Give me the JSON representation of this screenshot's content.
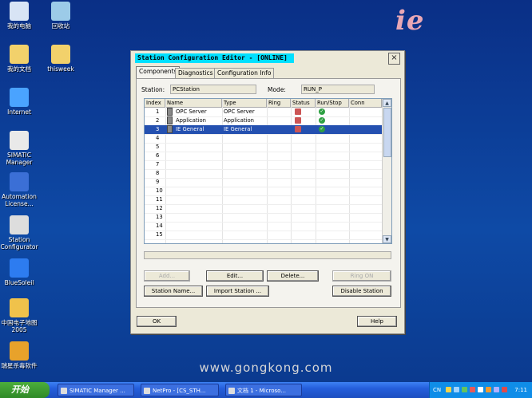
{
  "desktop": {
    "icons": [
      {
        "label": "我的电脑",
        "icon": "my-computer-icon",
        "color": "#d8e4f5"
      },
      {
        "label": "回收站",
        "icon": "recycle-bin-icon",
        "color": "#9ccbe8"
      },
      {
        "label": "我的文档",
        "icon": "my-documents-icon",
        "color": "#f2d16b"
      },
      {
        "label": "thisweek",
        "icon": "folder-icon",
        "color": "#f2d16b"
      },
      {
        "label": "Internet",
        "icon": "internet-explorer-icon",
        "color": "#4aa3ff"
      },
      {
        "label": "SIMATIC\nManager",
        "icon": "simatic-manager-icon",
        "color": "#e9e9e9"
      },
      {
        "label": "Automation\nLicense...",
        "icon": "automation-license-icon",
        "color": "#3b6fd6"
      },
      {
        "label": "Station\nConfigurator",
        "icon": "station-configurator-icon",
        "color": "#dddddd"
      },
      {
        "label": "BlueSoleil",
        "icon": "bluesoleil-icon",
        "color": "#2d7cf0"
      },
      {
        "label": "中国电子地图\n2005",
        "icon": "map-icon",
        "color": "#f0c24b"
      },
      {
        "label": "瑞星杀毒软件",
        "icon": "antivirus-lion-icon",
        "color": "#e8a22b"
      }
    ]
  },
  "watermark": {
    "top": "ie",
    "bottom": "www.gongkong.com"
  },
  "dialog": {
    "title": "Station Configuration Editor - [ONLINE]",
    "close": "×",
    "tabs": [
      "Components",
      "Diagnostics",
      "Configuration Info"
    ],
    "station_label": "Station:",
    "station_value": "PCStation",
    "mode_label": "Mode:",
    "mode_value": "RUN_P",
    "columns": [
      "Index",
      "Name",
      "Type",
      "Ring",
      "Status",
      "Run/Stop",
      "Conn"
    ],
    "rows": [
      {
        "index": "1",
        "name": "OPC Server",
        "type": "OPC Server",
        "status": true,
        "run": true
      },
      {
        "index": "2",
        "name": "Application",
        "type": "Application",
        "status": true,
        "run": true
      },
      {
        "index": "3",
        "name": "IE General",
        "type": "IE General",
        "status": true,
        "run": true,
        "selected": true
      },
      {
        "index": "4"
      },
      {
        "index": "5"
      },
      {
        "index": "6"
      },
      {
        "index": "7"
      },
      {
        "index": "8"
      },
      {
        "index": "9"
      },
      {
        "index": "10"
      },
      {
        "index": "11"
      },
      {
        "index": "12"
      },
      {
        "index": "13"
      },
      {
        "index": "14"
      },
      {
        "index": "15"
      }
    ],
    "buttons": {
      "add": "Add...",
      "edit": "Edit...",
      "delete": "Delete...",
      "ring_on": "Ring ON",
      "station_name": "Station Name...",
      "import_station": "Import Station ...",
      "disable_station": "Disable Station",
      "ok": "OK",
      "help": "Help"
    }
  },
  "taskbar": {
    "start": "开始",
    "tasks": [
      "SIMATIC Manager ...",
      "NetPro - [CS_STH...",
      "文档 1 - Microso..."
    ],
    "tray_lang": "CN",
    "clock": "7:11"
  }
}
